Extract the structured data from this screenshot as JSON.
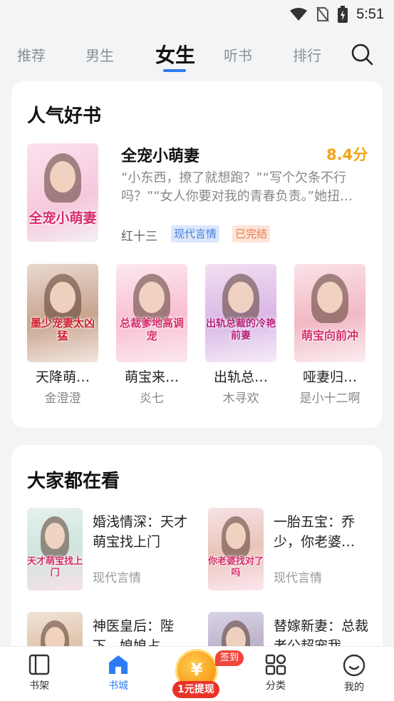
{
  "status_bar": {
    "time": "5:51"
  },
  "tabs": [
    {
      "label": "推荐"
    },
    {
      "label": "男生"
    },
    {
      "label": "女生"
    },
    {
      "label": "听书"
    },
    {
      "label": "排行"
    }
  ],
  "popular": {
    "title": "人气好书",
    "featured": {
      "title": "全宠小萌妻",
      "score": "8.4分",
      "description": "“小东西，撩了就想跑？”“写个欠条不行吗？”“女人你要对我的青春负责。”她扭…",
      "author": "红十三",
      "tags": [
        "现代言情",
        "已完结"
      ],
      "cover_text": "全宠小萌妻"
    },
    "books": [
      {
        "title": "天降萌…",
        "author": "金澄澄",
        "cover_text": "墨少宠妻太凶猛"
      },
      {
        "title": "萌宝来…",
        "author": "炎七",
        "cover_text": "总裁爹地高调宠"
      },
      {
        "title": "出轨总…",
        "author": "木寻欢",
        "cover_text": "出轨总裁的冷艳前妻"
      },
      {
        "title": "哑妻归…",
        "author": "是小十二啊",
        "cover_text": "萌宝向前冲"
      }
    ]
  },
  "watching": {
    "title": "大家都在看",
    "items": [
      {
        "title": "婚浅情深：天才萌宝找上门",
        "category": "现代言情",
        "cover_text": "天才萌宝找上门"
      },
      {
        "title": "一胎五宝：乔少，你老婆…",
        "category": "现代言情",
        "cover_text": "你老婆找对了吗"
      },
      {
        "title": "神医皇后：陛下，娘娘占…",
        "category": "",
        "cover_text": ""
      },
      {
        "title": "替嫁新妻：总裁老公超宠我",
        "category": "",
        "cover_text": ""
      }
    ]
  },
  "bottom_nav": {
    "items": [
      {
        "label": "书架"
      },
      {
        "label": "书城"
      },
      {
        "label": "分类"
      },
      {
        "label": "我的"
      }
    ],
    "sign_badge": "签到",
    "withdraw": "1元提现",
    "coin_symbol": "¥"
  },
  "colors": {
    "accent": "#2d7cf6",
    "score": "#f2a516",
    "red": "#e8332a"
  }
}
